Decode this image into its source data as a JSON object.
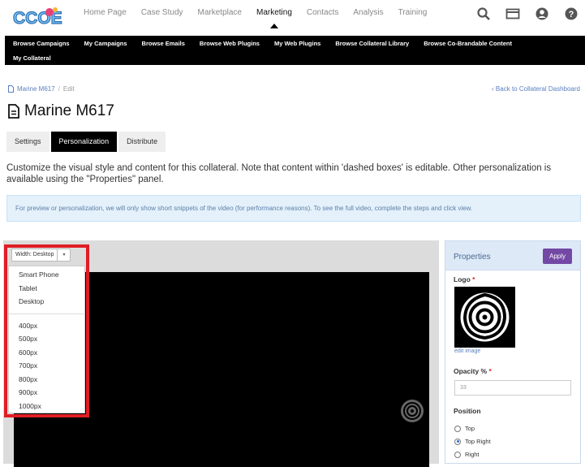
{
  "app": {
    "logo_text": "CCOE"
  },
  "nav": {
    "items": [
      "Home Page",
      "Case Study",
      "Marketplace",
      "Marketing",
      "Contacts",
      "Analysis",
      "Training"
    ],
    "active": "Marketing"
  },
  "subnav": {
    "row1": [
      "Browse Campaigns",
      "My Campaigns",
      "Browse Emails",
      "Browse Web Plugins",
      "My Web Plugins",
      "Browse Collateral Library",
      "Browse Co-Brandable Content"
    ],
    "row2": [
      "My Collateral"
    ]
  },
  "breadcrumb": {
    "item": "Marine M617",
    "sep": "/",
    "current": "Edit"
  },
  "back_link": "‹ Back to Collateral Dashboard",
  "page_title": "Marine M617",
  "tabs": [
    "Settings",
    "Personalization",
    "Distribute"
  ],
  "active_tab": "Personalization",
  "description": "Customize the visual style and content for this collateral. Note that content within 'dashed boxes' is editable. Other personalization is available using the \"Properties\" panel.",
  "info_text": "For preview or personalization, we will only show short snippets of the video (for performance reasons). To see the full video, complete the steps and click view.",
  "width_dropdown": {
    "label": "Width: Desktop",
    "caret": "▾",
    "device_options": [
      "Smart Phone",
      "Tablet",
      "Desktop"
    ],
    "px_options": [
      "400px",
      "500px",
      "600px",
      "700px",
      "800px",
      "900px",
      "1000px"
    ]
  },
  "properties": {
    "title": "Properties",
    "apply_label": "Apply",
    "logo_label": "Logo",
    "required_mark": "*",
    "edit_image": "edit image",
    "opacity_label": "Opacity %",
    "opacity_value": "33",
    "position_label": "Position",
    "position_options": [
      "Top",
      "Top Right",
      "Right"
    ],
    "position_selected": "Top Right"
  },
  "colors": {
    "accent": "#7349a5",
    "highlight": "#e01d25",
    "link": "#5a7fbf"
  }
}
